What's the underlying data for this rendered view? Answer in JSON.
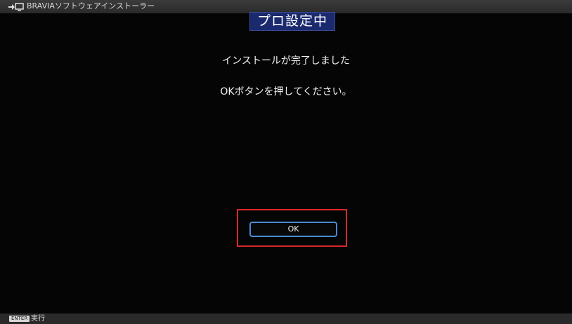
{
  "window": {
    "title": "BRAVIAソフトウェアインストーラー",
    "app_icon": "input-connector-icon"
  },
  "badge": {
    "label": "プロ設定中"
  },
  "message": {
    "line1": "インストールが完了しました",
    "line2": "OKボタンを押してください。"
  },
  "dialog": {
    "ok_label": "OK",
    "focused_button": "OK"
  },
  "footer": {
    "key_label": "ENTER",
    "action_label": "実行"
  },
  "colors": {
    "background": "#050505",
    "badge": "#1b2a6e",
    "focus_frame": "#d8282c",
    "button_border": "#4a8ad6"
  }
}
